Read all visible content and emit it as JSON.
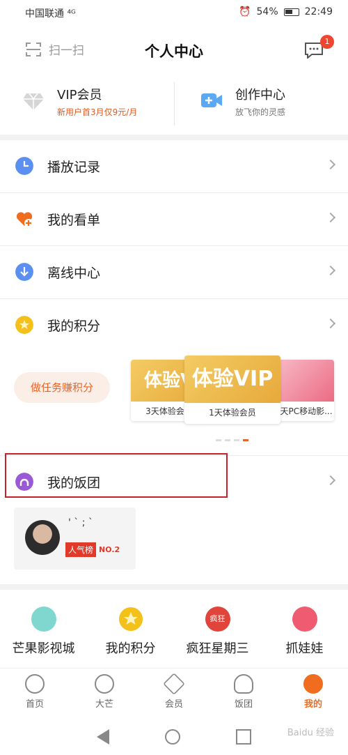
{
  "status_bar": {
    "carrier": "中国联通 ⁴ᴳ",
    "battery": "54%",
    "time": "22:49"
  },
  "header": {
    "scan_label": "扫一扫",
    "title": "个人中心",
    "msg_badge": "1"
  },
  "top_cards": [
    {
      "title": "VIP会员",
      "subtitle": "新用户首3月仅9元/月"
    },
    {
      "title": "创作中心",
      "subtitle": "放飞你的灵感"
    }
  ],
  "menu": [
    {
      "label": "播放记录",
      "icon": "clock-icon",
      "color": "#4a86e8"
    },
    {
      "label": "我的看单",
      "icon": "heart-plus-icon",
      "color": "#f06d1f"
    },
    {
      "label": "离线中心",
      "icon": "download-icon",
      "color": "#4a86e8"
    },
    {
      "label": "我的积分",
      "icon": "star-coin-icon",
      "color": "#f2b705"
    }
  ],
  "points": {
    "task_button": "做任务赚积分",
    "prizes": [
      {
        "image_text": "体验V",
        "caption": "3天体验会员"
      },
      {
        "image_text": "体验VIP",
        "caption": "1天体验会员"
      },
      {
        "image_text": "",
        "caption": "天PC移动影..."
      }
    ],
    "page_count": 4,
    "active_page": 4
  },
  "fan_group": {
    "label": "我的饭团",
    "name": "' ` ; `",
    "rank_tag": "人气榜",
    "rank_no": "NO.2"
  },
  "shortcuts": [
    {
      "label": "芒果影视城",
      "icon": "mango-city-icon",
      "color": "#5cc7c0"
    },
    {
      "label": "我的积分",
      "icon": "star-coin-icon",
      "color": "#f2b705"
    },
    {
      "label": "疯狂星期三",
      "icon": "crazy-wednesday-icon",
      "color": "#e0443a"
    },
    {
      "label": "抓娃娃",
      "icon": "claw-machine-icon",
      "color": "#ef5c72"
    }
  ],
  "tabs": [
    {
      "label": "首页",
      "icon": "home-icon"
    },
    {
      "label": "大芒",
      "icon": "damang-icon"
    },
    {
      "label": "会员",
      "icon": "vip-icon"
    },
    {
      "label": "饭团",
      "icon": "fantuan-icon"
    },
    {
      "label": "我的",
      "icon": "profile-icon"
    }
  ],
  "crazy_badge_text": "疯狂",
  "watermark": "Baidu 经验",
  "colors": {
    "accent": "#f06d1f",
    "highlight_box": "#c8202a"
  }
}
